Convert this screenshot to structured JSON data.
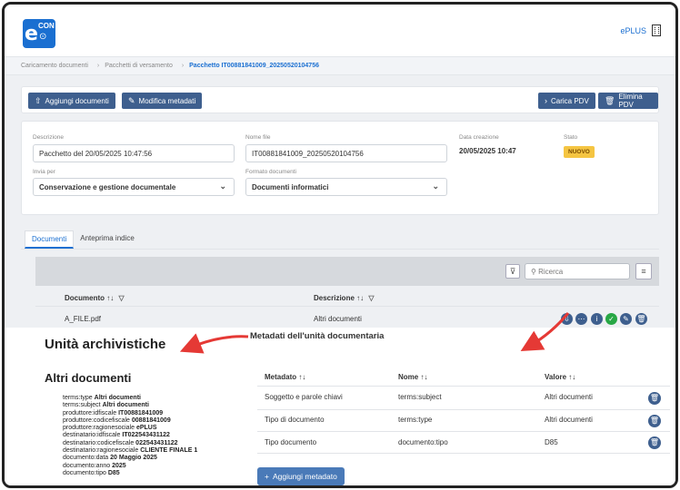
{
  "brand": {
    "logo_letter": "e",
    "logo_top": "CON",
    "logo_sub": "⊙"
  },
  "user": {
    "name": "ePLUS"
  },
  "breadcrumb": [
    "Caricamento documenti",
    "Pacchetti di versamento",
    "Pacchetto IT00881841009_20250520104756"
  ],
  "toolbar": {
    "add_docs": "Aggiungi documenti",
    "edit_meta": "Modifica metadati",
    "load_pdv": "Carica PDV",
    "delete_pdv": "Elimina PDV"
  },
  "form": {
    "descrizione_label": "Descrizione",
    "descrizione_value": "Pacchetto del 20/05/2025 10:47:56",
    "nome_file_label": "Nome file",
    "nome_file_value": "IT00881841009_20250520104756",
    "data_label": "Data creazione",
    "data_value": "20/05/2025 10:47",
    "stato_label": "Stato",
    "stato_value": "NUOVO",
    "invia_label": "Invia per",
    "invia_value": "Conservazione e gestione documentale",
    "formato_label": "Formato documenti",
    "formato_value": "Documenti informatici"
  },
  "tabs": [
    "Documenti",
    "Anteprima indice"
  ],
  "search": {
    "placeholder": "Ricerca"
  },
  "documents_table": {
    "columns": [
      "Documento ↑↓",
      "Descrizione ↑↓"
    ],
    "rows": [
      {
        "documento": "A_FILE.pdf",
        "descrizione": "Altri documenti"
      }
    ]
  },
  "overlay": {
    "unita_title": "Unità archivistiche",
    "metadati_title": "Metadati dell'unità documentaria",
    "altri_title": "Altri documenti",
    "meta_lines": [
      {
        "k": "terms:type",
        "v": "Altri documenti"
      },
      {
        "k": "terms:subject",
        "v": "Altri documenti"
      },
      {
        "k": "produttore:idfiscale",
        "v": "IT00881841009"
      },
      {
        "k": "produttore:codicefiscale",
        "v": "00881841009"
      },
      {
        "k": "produttore:ragionesociale",
        "v": "ePLUS"
      },
      {
        "k": "destinatario:idfiscale",
        "v": "IT022543431122"
      },
      {
        "k": "destinatario:codicefiscale",
        "v": "022543431122"
      },
      {
        "k": "destinatario:ragionesociale",
        "v": "CLIENTE FINALE 1"
      },
      {
        "k": "documento:data",
        "v": "20 Maggio 2025"
      },
      {
        "k": "documento:anno",
        "v": "2025"
      },
      {
        "k": "documento:tipo",
        "v": "D85"
      }
    ],
    "meta_table": {
      "columns": [
        "Metadato ↑↓",
        "Nome ↑↓",
        "Valore ↑↓"
      ],
      "rows": [
        {
          "metadato": "Soggetto e parole chiavi",
          "nome": "terms:subject",
          "valore": "Altri documenti"
        },
        {
          "metadato": "Tipo di documento",
          "nome": "terms:type",
          "valore": "Altri documenti"
        },
        {
          "metadato": "Tipo documento",
          "nome": "documento:tipo",
          "valore": "D85"
        }
      ]
    },
    "add_meta": "Aggiungi metadato"
  },
  "colors": {
    "primary": "#3e5f8e",
    "accent": "#1a6fd1",
    "badge": "#f5c542",
    "arrow": "#e53935"
  }
}
